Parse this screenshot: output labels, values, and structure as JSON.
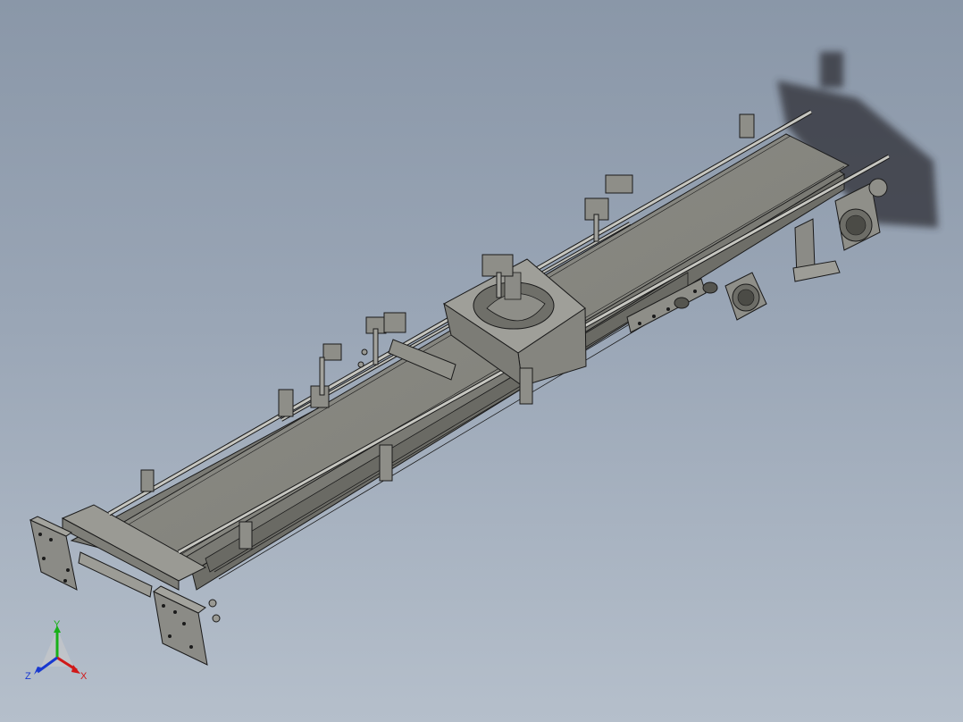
{
  "viewport": {
    "background_top": "#8a97a8",
    "background_bottom": "#b5bfcb",
    "model_body_color": "#8b8b86",
    "model_edge_color": "#1a1a1a"
  },
  "triad": {
    "x_label": "X",
    "y_label": "Y",
    "z_label": "Z",
    "x_color": "#d01818",
    "y_color": "#18b018",
    "z_color": "#1838d0"
  }
}
